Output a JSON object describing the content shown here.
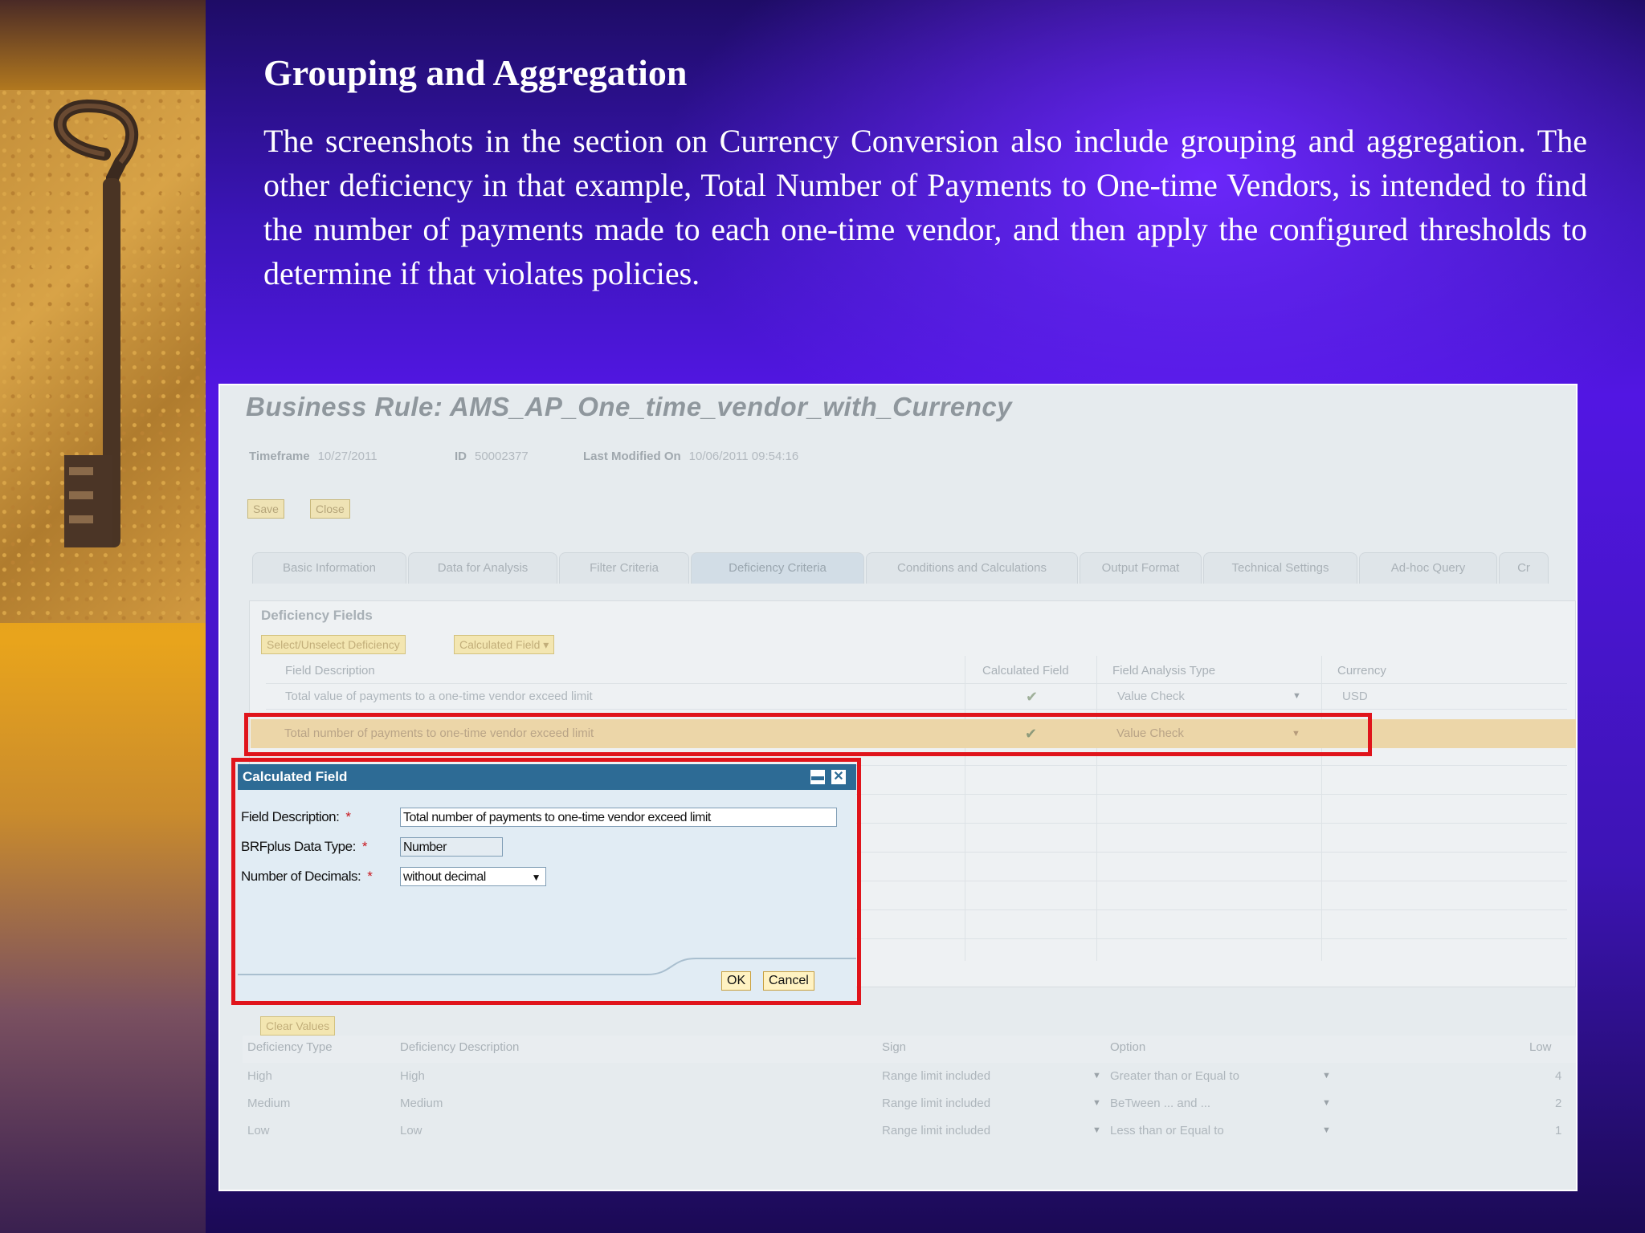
{
  "slide": {
    "title": "Grouping and Aggregation",
    "body": "The screenshots in the section on Currency Conversion also include grouping and aggregation. The other deficiency in that example, Total Number of Payments to One-time Vendors, is intended to find the number of payments made to each one-time vendor, and then apply the configured thresholds to determine if that violates policies."
  },
  "screenshot": {
    "title": "Business Rule: AMS_AP_One_time_vendor_with_Currency",
    "meta": {
      "timeframe_label": "Timeframe",
      "timeframe_value": "10/27/2011",
      "id_label": "ID",
      "id_value": "50002377",
      "modified_label": "Last Modified On",
      "modified_value": "10/06/2011 09:54:16"
    },
    "toolbar": {
      "save": "Save",
      "close": "Close"
    },
    "tabs": [
      {
        "label": "Basic Information"
      },
      {
        "label": "Data for Analysis"
      },
      {
        "label": "Filter Criteria"
      },
      {
        "label": "Deficiency Criteria"
      },
      {
        "label": "Conditions and Calculations"
      },
      {
        "label": "Output Format"
      },
      {
        "label": "Technical Settings"
      },
      {
        "label": "Ad-hoc Query"
      },
      {
        "label": "Cr"
      }
    ],
    "active_tab": "Deficiency Criteria",
    "deficiency_fields": {
      "title": "Deficiency Fields",
      "buttons": {
        "select": "Select/Unselect Deficiency",
        "calc": "Calculated Field"
      },
      "columns": [
        "Field Description",
        "Calculated Field",
        "Field Analysis Type",
        "Currency"
      ],
      "rows": [
        {
          "description": "Total value of payments to a one-time vendor exceed limit",
          "calculated": "✔",
          "analysis_type": "Value Check",
          "currency": "USD"
        },
        {
          "description": "Total number of payments to one-time vendor exceed limit",
          "calculated": "✔",
          "analysis_type": "Value Check",
          "currency": ""
        }
      ]
    },
    "dialog": {
      "title": "Calculated Field",
      "field_description_label": "Field Description:",
      "field_description_value": "Total number of payments to one-time vendor exceed limit",
      "data_type_label": "BRFplus Data Type:",
      "data_type_value": "Number",
      "decimals_label": "Number of Decimals:",
      "decimals_value": "without decimal",
      "required_mark": "*",
      "ok": "OK",
      "cancel": "Cancel"
    },
    "thresholds": {
      "clear_button": "Clear Values",
      "columns": [
        "Deficiency Type",
        "Deficiency Description",
        "Sign",
        "Option",
        "Low"
      ],
      "rows": [
        {
          "type": "High",
          "description": "High",
          "sign": "Range limit included",
          "option": "Greater than or Equal to",
          "low": "4"
        },
        {
          "type": "Medium",
          "description": "Medium",
          "sign": "Range limit included",
          "option": "BeTween ... and ...",
          "low": "2"
        },
        {
          "type": "Low",
          "description": "Low",
          "sign": "Range limit included",
          "option": "Less than or Equal to",
          "low": "1"
        }
      ]
    }
  },
  "colors": {
    "highlight_red": "#e0141b",
    "dialog_header": "#2d6b95",
    "slide_purple": "#5216e3"
  }
}
